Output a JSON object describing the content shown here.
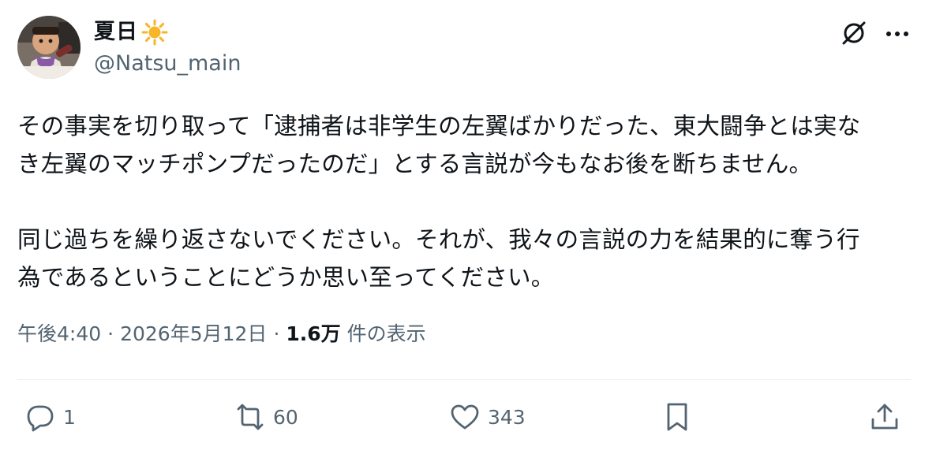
{
  "author": {
    "display_name": "夏日",
    "name_emoji_icon": "sun-icon",
    "handle": "@Natsu_main"
  },
  "header_icons": [
    "grok-icon",
    "more-icon"
  ],
  "tweet": {
    "paragraphs": [
      "その事実を切り取って「逮捕者は非学生の左翼ばかりだった、東大闘争とは実な\nき左翼のマッチポンプだったのだ」とする言説が今もなお後を断ちません。",
      "同じ過ちを繰り返さないでください。それが、我々の言説の力を結果的に奪う行\n為であるということにどうか思い至ってください。"
    ]
  },
  "meta": {
    "time": "午後4:40",
    "separator": "·",
    "date": "2026年5月12日",
    "views": "1.6万",
    "views_label": "件の表示"
  },
  "actions": {
    "reply": {
      "icon": "reply-icon",
      "count": "1"
    },
    "retweet": {
      "icon": "retweet-icon",
      "count": "60"
    },
    "like": {
      "icon": "heart-icon",
      "count": "343"
    },
    "bookmark": {
      "icon": "bookmark-icon"
    },
    "share": {
      "icon": "share-icon"
    }
  },
  "colors": {
    "text_primary": "#0f1419",
    "text_secondary": "#536471",
    "divider": "#eff3f4",
    "sun": "#f7b529"
  }
}
